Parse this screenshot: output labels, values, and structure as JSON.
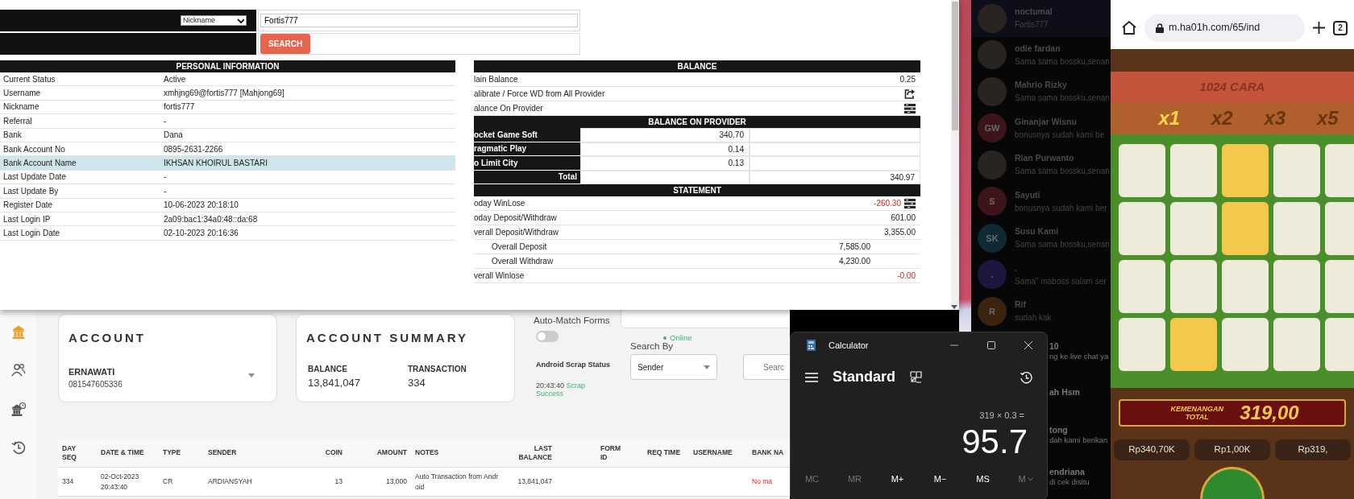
{
  "popup": {
    "search": {
      "type": "Nickname",
      "value": "Fortis777",
      "button": "SEARCH"
    },
    "personal_information": {
      "title": "PERSONAL INFORMATION",
      "rows": [
        {
          "label": "Current Status",
          "value": "Active",
          "selected": false
        },
        {
          "label": "Username",
          "value": "xmhjng69@fortis777  [Mahjong69]",
          "selected": false
        },
        {
          "label": "Nickname",
          "value": "fortis777",
          "selected": false
        },
        {
          "label": "Referral",
          "value": "-",
          "selected": false
        },
        {
          "label": "Bank",
          "value": "Dana",
          "selected": false
        },
        {
          "label": "Bank Account No",
          "value": "0895-2631-2266",
          "selected": false
        },
        {
          "label": "Bank Account Name",
          "value": "IKHSAN KHOIRUL BASTARI",
          "selected": true
        },
        {
          "label": "Last Update Date",
          "value": "-",
          "selected": false
        },
        {
          "label": "Last Update By",
          "value": "-",
          "selected": false
        },
        {
          "label": "Register Date",
          "value": "10-06-2023 20:18:10",
          "selected": false
        },
        {
          "label": "Last Login IP",
          "value": "2a09:bac1:34a0:48::da:68",
          "selected": false
        },
        {
          "label": "Last Login Date",
          "value": "02-10-2023 20:16:36",
          "selected": false
        }
      ]
    },
    "balance": {
      "title": "BALANCE",
      "rows": [
        {
          "kind": "value",
          "label": "lain Balance",
          "value": "0.25"
        },
        {
          "kind": "share",
          "label": "alibrate / Force WD from All Provider"
        },
        {
          "kind": "list",
          "label": "alance On Provider"
        }
      ]
    },
    "balance_on_provider": {
      "title": "BALANCE ON PROVIDER",
      "rows": [
        {
          "provider": "ocket Game Soft",
          "amount": "340.70"
        },
        {
          "provider": "ragmatic Play",
          "amount": "0.14"
        },
        {
          "provider": "o Limit City",
          "amount": "0.13"
        }
      ],
      "total_label": "Total",
      "total": "340.97"
    },
    "statement": {
      "title": "STATEMENT",
      "rows": [
        {
          "kind": "main",
          "label": "oday WinLose",
          "value": "-260.30",
          "negative": true,
          "list_icon": true
        },
        {
          "kind": "main",
          "label": "oday Deposit/Withdraw",
          "value": "601.00",
          "negative": false,
          "list_icon": false
        },
        {
          "kind": "main",
          "label": "verall Deposit/Withdraw",
          "value": "3,355.00",
          "negative": false,
          "list_icon": false
        },
        {
          "kind": "sub",
          "label": "Overall Deposit",
          "value": "7,585.00",
          "negative": false,
          "list_icon": false
        },
        {
          "kind": "sub",
          "label": "Overall Withdraw",
          "value": "4,230.00",
          "negative": false,
          "list_icon": false
        },
        {
          "kind": "main",
          "label": "verall Winlose",
          "value": "-0.00",
          "negative": true,
          "list_icon": false
        }
      ]
    }
  },
  "dashboard": {
    "sidebar": [
      {
        "selected": true
      },
      {
        "selected": false
      },
      {
        "selected": false
      },
      {
        "selected": false
      }
    ],
    "account": {
      "title": "ACCOUNT",
      "name": "ERNAWATI",
      "number": "081547605336"
    },
    "summary": {
      "title": "ACCOUNT SUMMARY",
      "balance_label": "BALANCE",
      "balance": "13,841,047",
      "transaction_label": "TRANSACTION",
      "transaction": "334"
    },
    "auto_match": {
      "label": "Auto-Match Forms",
      "on": false
    },
    "online_status": "Online",
    "scrap": {
      "label": "Android Scrap Status",
      "time": "20:43:40",
      "status": "Scrap Success"
    },
    "search_by": {
      "label": "Search By",
      "value": "Sender"
    },
    "search": {
      "placeholder": "Searc"
    },
    "table": {
      "columns": [
        "DAY SEQ",
        "DATE & TIME",
        "TYPE",
        "SENDER",
        "COIN",
        "AMOUNT",
        "NOTES",
        "LAST BALANCE",
        "FORM ID",
        "REQ TIME",
        "USERNAME",
        "BANK NA"
      ],
      "rows": [
        {
          "cells": [
            "334",
            "02-Oct-2023 20:43:40",
            "CR",
            "ARDIANSYAH",
            "13",
            "13,000",
            "Auto Transaction from Android",
            "13,841,047"
          ],
          "bank_name": "No ma"
        }
      ]
    }
  },
  "chat": [
    {
      "name": "noctumal",
      "preview": "Fortis777",
      "kind": "photo",
      "selected": true,
      "partial": false
    },
    {
      "name": "odie fardan",
      "preview": "Sama sama bossku,senan",
      "kind": "photo",
      "selected": false,
      "partial": false
    },
    {
      "name": "Mahrio Rizky",
      "preview": "Sama sama bossku,senan",
      "kind": "photo",
      "selected": false,
      "partial": false
    },
    {
      "name": "Ginanjar Wisnu",
      "preview": "bonusnya sudah kami be",
      "kind": "initials",
      "initials": "GW",
      "color": "#3b1519",
      "selected": false,
      "partial": false
    },
    {
      "name": "Rian Purwanto",
      "preview": "Sama sama bossku,senan",
      "kind": "photo",
      "selected": false,
      "partial": false
    },
    {
      "name": "Sayuti",
      "preview": "bonusnya sudah kami ber",
      "kind": "initials",
      "initials": "S",
      "color": "#3d1418",
      "selected": false,
      "partial": false
    },
    {
      "name": "Susu Kami",
      "preview": "Sama sama bossku,senan",
      "kind": "initials",
      "initials": "SK",
      "color": "#0f2a33",
      "selected": false,
      "partial": false
    },
    {
      "name": ".",
      "preview": "Sama\" maboss salam ser",
      "kind": "initials",
      "initials": ".",
      "color": "#1c1640",
      "selected": false,
      "partial": false
    },
    {
      "name": "Rif",
      "preview": "sudah kak",
      "kind": "initials",
      "initials": "R",
      "color": "#3a2410",
      "selected": false,
      "partial": false
    },
    {
      "name": "10",
      "preview": "ng ke live chat ya",
      "selected": false,
      "partial": true
    },
    {
      "name": "ah Hsm",
      "selected": false,
      "partial": true
    },
    {
      "name": "tong",
      "preview": "dah kami berikan",
      "selected": false,
      "partial": true
    },
    {
      "name": "endriana",
      "preview": "di cek disitu",
      "selected": false,
      "partial": true
    }
  ],
  "calculator": {
    "title": "Calculator",
    "mode": "Standard",
    "expression": "319 × 0.3 =",
    "display": "95.7",
    "memory_buttons": [
      {
        "label": "MC",
        "disabled": true,
        "kind": "plain"
      },
      {
        "label": "MR",
        "disabled": true,
        "kind": "plain"
      },
      {
        "label": "M+",
        "disabled": false,
        "kind": "plain"
      },
      {
        "label": "M−",
        "disabled": false,
        "kind": "plain"
      },
      {
        "label": "MS",
        "disabled": false,
        "kind": "plain"
      },
      {
        "label": "M",
        "disabled": true,
        "kind": "dropdown"
      }
    ]
  },
  "phone": {
    "url": "m.ha01h.com/65/ind",
    "tab_count": "2",
    "game": {
      "title": "1024 CARA",
      "multipliers": [
        {
          "label": "x1",
          "selected": true
        },
        {
          "label": "x2",
          "selected": false
        },
        {
          "label": "x3",
          "selected": false
        },
        {
          "label": "x5",
          "selected": false
        }
      ],
      "win_label": "KEMENANGAN TOTAL",
      "win_amount": "319,00",
      "balances": [
        "Rp340,70K",
        "Rp1,00K",
        "Rp319,"
      ]
    }
  }
}
